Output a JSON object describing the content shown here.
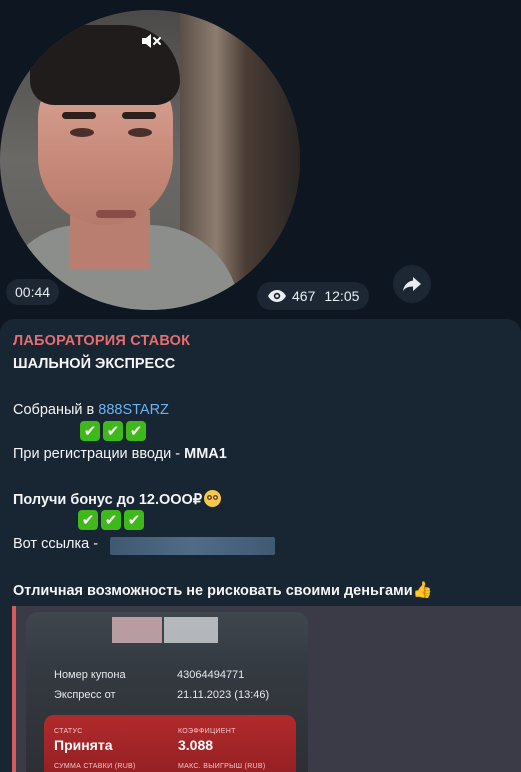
{
  "video_message": {
    "duration": "00:44",
    "views": "467",
    "time": "12:05",
    "icons": {
      "mute": "muted-speaker-icon",
      "views": "eye-icon",
      "forward": "forward-arrow-icon"
    }
  },
  "post": {
    "sender": "ЛАБОРАТОРИЯ СТАВОК",
    "title": "ШАЛЬНОЙ ЭКСПРЕСС",
    "collected_prefix": "Собраный в ",
    "collected_link": "888STARZ",
    "promo_prefix": "При регистрации вводи  - ",
    "promo_code": "MMA1",
    "bonus": "Получи бонус до 12.OOO₽",
    "link_prefix": "Вот ссылка - ",
    "closing": "Отличная возможность не рисковать своими деньгами",
    "check_emoji": "✔",
    "colors": {
      "sender": "#e56e6e",
      "link": "#6ab3f3",
      "bubble": "#182533",
      "background": "#0e1621"
    }
  },
  "coupon": {
    "coupon_number_label": "Номер купона",
    "coupon_number": "43064494771",
    "express_label": "Экспресс от",
    "express_date": "21.11.2023 (13:46)",
    "status_label": "СТАТУС",
    "status_value": "Принята",
    "coef_label": "КОЭФФИЦИЕНТ",
    "coef_value": "3.088",
    "stake_label": "СУММА СТАВКИ (RUB)",
    "max_win_label": "МАКС. ВЫИГРЫШ (RUB)"
  }
}
